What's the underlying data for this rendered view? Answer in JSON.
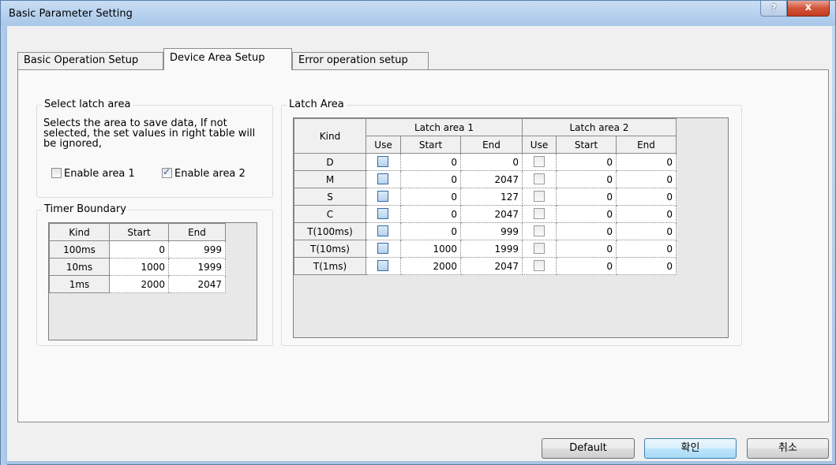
{
  "window": {
    "title": "Basic Parameter Setting",
    "help_label": "?",
    "close_label": "x"
  },
  "tabs": [
    {
      "label": "Basic Operation Setup",
      "active": false
    },
    {
      "label": "Device Area Setup",
      "active": true
    },
    {
      "label": "Error operation setup",
      "active": false
    }
  ],
  "select_latch": {
    "title": "Select latch area",
    "description": "Selects the area to save data, If not selected, the set values in right table will be ignored,",
    "enable1_label": "Enable area 1",
    "enable1_checked": false,
    "enable2_label": "Enable area 2",
    "enable2_checked": true
  },
  "timer": {
    "title": "Timer Boundary",
    "headers": [
      "Kind",
      "Start",
      "End"
    ],
    "rows": [
      {
        "kind": "100ms",
        "start": "0",
        "end": "999"
      },
      {
        "kind": "10ms",
        "start": "1000",
        "end": "1999"
      },
      {
        "kind": "1ms",
        "start": "2000",
        "end": "2047"
      }
    ]
  },
  "latch": {
    "title": "Latch Area",
    "kind_header": "Kind",
    "area1_header": "Latch area 1",
    "area2_header": "Latch area 2",
    "sub_headers": [
      "Use",
      "Start",
      "End"
    ],
    "rows": [
      {
        "kind": "D",
        "s1": "0",
        "e1": "0",
        "s2": "0",
        "e2": "0"
      },
      {
        "kind": "M",
        "s1": "0",
        "e1": "2047",
        "s2": "0",
        "e2": "0"
      },
      {
        "kind": "S",
        "s1": "0",
        "e1": "127",
        "s2": "0",
        "e2": "0"
      },
      {
        "kind": "C",
        "s1": "0",
        "e1": "2047",
        "s2": "0",
        "e2": "0"
      },
      {
        "kind": "T(100ms)",
        "s1": "0",
        "e1": "999",
        "s2": "0",
        "e2": "0"
      },
      {
        "kind": "T(10ms)",
        "s1": "1000",
        "e1": "1999",
        "s2": "0",
        "e2": "0"
      },
      {
        "kind": "T(1ms)",
        "s1": "2000",
        "e1": "2047",
        "s2": "0",
        "e2": "0"
      }
    ]
  },
  "buttons": {
    "default": "Default",
    "ok": "확인",
    "cancel": "취소"
  },
  "colors": {
    "titlebar": "#b4cfee",
    "close": "#c43b20",
    "focus_button": "#a7d9f5"
  }
}
